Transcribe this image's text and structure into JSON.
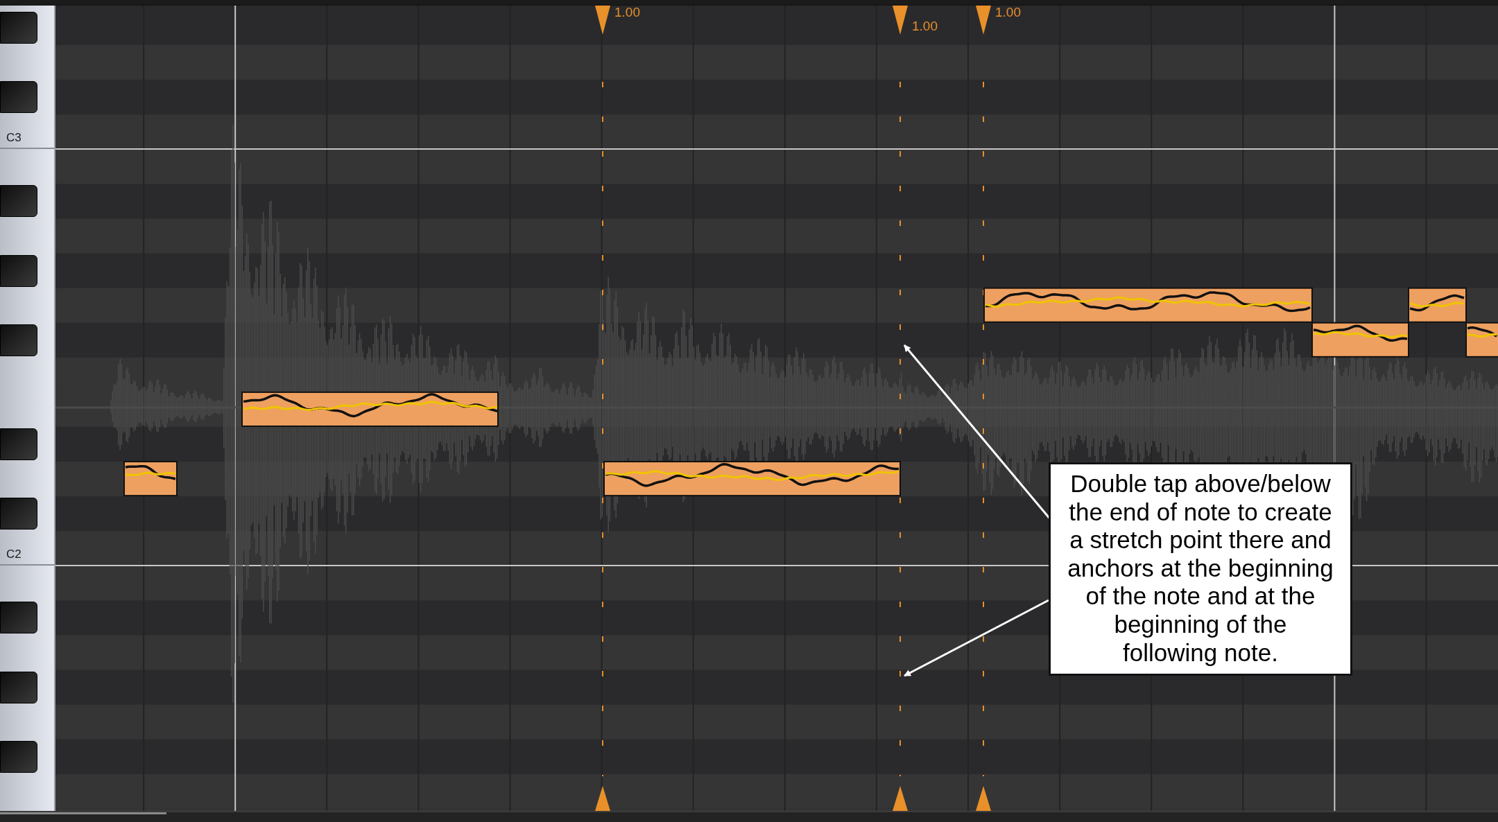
{
  "piano_keyboard": {
    "octave_labels": [
      {
        "text": "C3"
      },
      {
        "text": "C2"
      }
    ]
  },
  "stretch_markers": [
    {
      "value": "1.00"
    },
    {
      "value": "1.00"
    },
    {
      "value": "1.00"
    }
  ],
  "callout": {
    "text": "Double tap above/below the end of note to create a stretch point there and anchors at the beginning of the note and at the beginning of the following note."
  }
}
